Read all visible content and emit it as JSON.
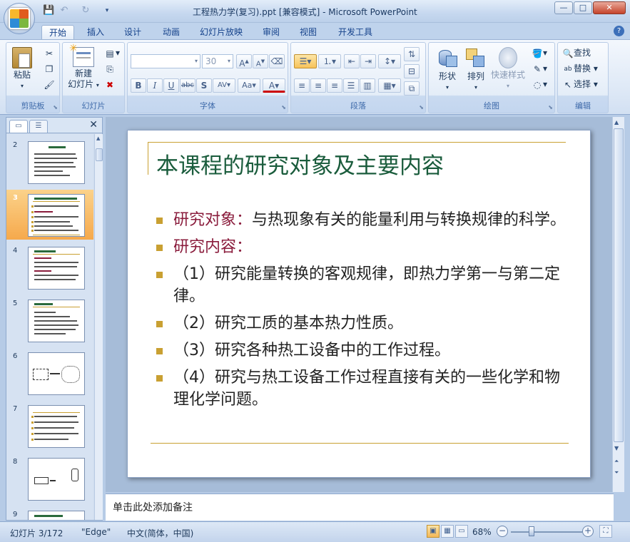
{
  "window": {
    "title": "工程热力学(复习).ppt [兼容模式] - Microsoft PowerPoint",
    "minimize": "—",
    "maximize": "□",
    "close": "✕"
  },
  "tabs": [
    "开始",
    "插入",
    "设计",
    "动画",
    "幻灯片放映",
    "审阅",
    "视图",
    "开发工具"
  ],
  "ribbon": {
    "clipboard": {
      "paste": "粘贴",
      "group": "剪贴板"
    },
    "slides": {
      "new_slide_line1": "新建",
      "new_slide_line2": "幻灯片",
      "group": "幻灯片"
    },
    "font": {
      "font_size": "30",
      "group": "字体"
    },
    "paragraph": {
      "group": "段落"
    },
    "drawing": {
      "shapes": "形状",
      "arrange": "排列",
      "quick_styles": "快速样式",
      "group": "绘图"
    },
    "editing": {
      "find": "查找",
      "replace": "替换",
      "select": "选择",
      "group": "编辑"
    }
  },
  "thumbnails": [
    {
      "num": "2"
    },
    {
      "num": "3"
    },
    {
      "num": "4"
    },
    {
      "num": "5"
    },
    {
      "num": "6"
    },
    {
      "num": "7"
    },
    {
      "num": "8"
    },
    {
      "num": "9"
    }
  ],
  "slide": {
    "title": "本课程的研究对象及主要内容",
    "bullets": [
      {
        "label": "研究对象：",
        "text": "与热现象有关的能量利用与转换规律的科学。"
      },
      {
        "label": "研究内容：",
        "text": ""
      },
      {
        "label": "",
        "text": "（1）研究能量转换的客观规律，即热力学第一与第二定律。"
      },
      {
        "label": "",
        "text": "（2）研究工质的基本热力性质。"
      },
      {
        "label": "",
        "text": "（3）研究各种热工设备中的工作过程。"
      },
      {
        "label": "",
        "text": "（4）研究与热工设备工作过程直接有关的一些化学和物理化学问题。"
      }
    ]
  },
  "notes_placeholder": "单击此处添加备注",
  "status": {
    "slide_indicator": "幻灯片 3/172",
    "theme": "\"Edge\"",
    "language": "中文(简体，中国)",
    "zoom": "68%"
  }
}
